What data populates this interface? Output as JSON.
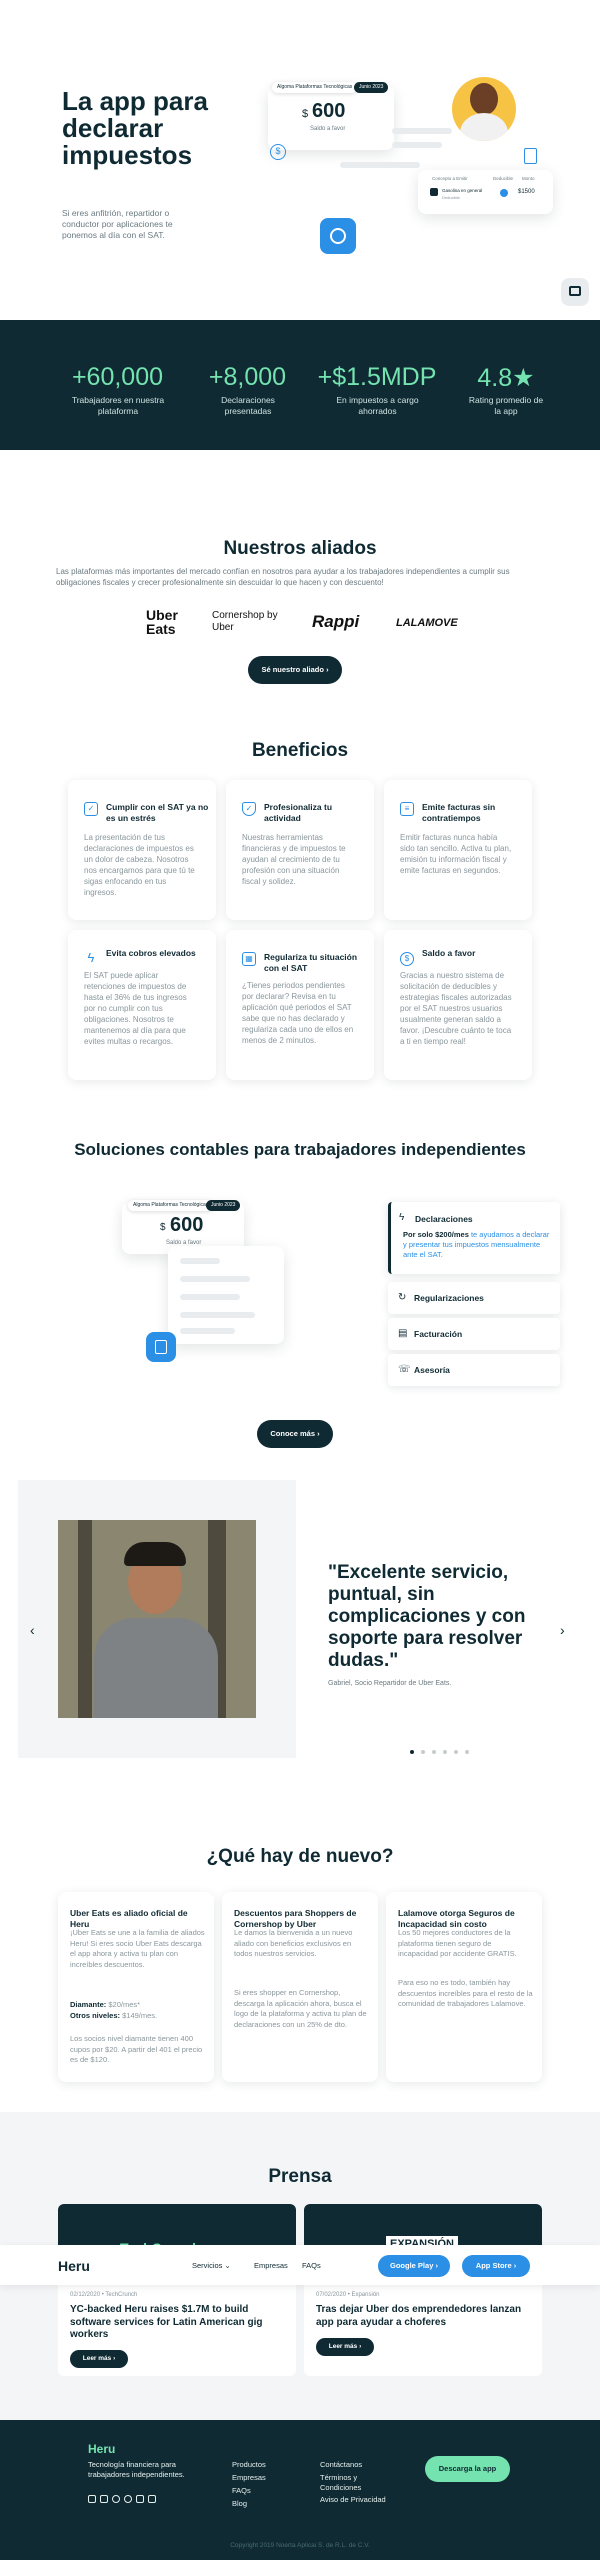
{
  "hero": {
    "title": "La app para declarar impuestos",
    "subtitle": "Si eres anfitrión, repartidor o conductor por aplicaciones te ponemos al día con el SAT.",
    "mock": {
      "badge_left": "Algoma Plataformas Tecnológicas",
      "badge_right": "Junio 2023",
      "amount_symbol": "$",
      "amount": "600",
      "amount_label": "Saldo a favor",
      "table_col1": "Concepto a Emitir",
      "table_col2": "Deducible",
      "table_col3": "Monto",
      "table_row_label": "Gasolina en general",
      "table_row_sub": "Deducible",
      "table_row_amount": "$1500"
    }
  },
  "stats": [
    {
      "value": "+60,000",
      "label": "Trabajadores en nuestra plataforma"
    },
    {
      "value": "+8,000",
      "label": "Declaraciones presentadas"
    },
    {
      "value": "+$1.5MDP",
      "label": "En impuestos a cargo ahorrados"
    },
    {
      "value": "4.8★",
      "label": "Rating promedio de la app"
    }
  ],
  "allies": {
    "title": "Nuestros aliados",
    "subtitle": "Las plataformas más importantes del mercado confían en nosotros para ayudar a los trabajadores independientes a cumplir sus obligaciones fiscales y crecer profesionalmente sin descuidar lo que hacen y con descuento!",
    "logos": [
      "Uber Eats",
      "Cornershop by Uber",
      "Rappi",
      "LALAMOVE"
    ],
    "cta": "Sé nuestro aliado"
  },
  "benefits": {
    "title": "Beneficios",
    "items": [
      {
        "icon": "check-square-icon",
        "title": "Cumplir con el SAT ya no es un estrés",
        "body": "La presentación de tus declaraciones de impuestos es un dolor de cabeza. Nosotros nos encargamos para que tú te sigas enfocando en tus ingresos."
      },
      {
        "icon": "shield-icon",
        "title": "Profesionaliza tu actividad",
        "body": "Nuestras herramientas financieras y de impuestos te ayudan al crecimiento de tu profesión con una situación fiscal y solidez."
      },
      {
        "icon": "document-icon",
        "title": "Emite facturas sin contratiempos",
        "body": "Emitir facturas nunca había sido tan sencillo. Activa tu plan, emisión tu información fiscal y emite facturas en segundos."
      },
      {
        "icon": "bolt-icon",
        "title": "Evita cobros elevados",
        "body": "El SAT puede aplicar retenciones de impuestos de hasta el 36% de tus ingresos por no cumplir con tus obligaciones. Nosotros te mantenemos al día para que evites multas o recargos."
      },
      {
        "icon": "calendar-icon",
        "title": "Regulariza tu situación con el SAT",
        "body": "¿Tienes periodos pendientes por declarar? Revisa en tu aplicación qué periodos el SAT sabe que no has declarado y regulariza cada uno de ellos en menos de 2 minutos."
      },
      {
        "icon": "dollar-icon",
        "title": "Saldo a favor",
        "body": "Gracias a nuestro sistema de solicitación de deducibles y estrategias fiscales autorizadas por el SAT nuestros usuarios usualmente generan saldo a favor. ¡Descubre cuánto te toca a ti en tiempo real!"
      }
    ]
  },
  "solutions": {
    "title": "Soluciones contables para trabajadores independientes",
    "mock": {
      "badge_left": "Algoma Plataformas Tecnológicas",
      "badge_right": "Junio 2023",
      "amount_symbol": "$",
      "amount": "600",
      "amount_label": "Saldo a favor"
    },
    "active": {
      "label": "Declaraciones",
      "desc_bold": "Por solo $200/mes",
      "desc_rest": " te ayudamos a declarar y presentar tus impuestos mensualmente ante el SAT."
    },
    "tabs": [
      {
        "icon": "refresh-icon",
        "label": "Regularizaciones"
      },
      {
        "icon": "receipt-icon",
        "label": "Facturación"
      },
      {
        "icon": "chat-icon",
        "label": "Asesoría"
      }
    ],
    "cta": "Conoce más"
  },
  "testimonial": {
    "quote": "\"Excelente servicio, puntual, sin complicaciones y con soporte para resolver dudas.\"",
    "author": "Gabriel, Socio Repartidor de Uber Eats.",
    "prev": "‹",
    "next": "›"
  },
  "news": {
    "title": "¿Qué hay de nuevo?",
    "items": [
      {
        "title": "Uber Eats es aliado oficial de Heru",
        "paragraphs": [
          "¡Uber Eats se une a la familia de aliados Heru! Si eres socio Uber Eats descarga el app ahora y activa tu plan con increíbles descuentos."
        ],
        "extra1_label": "Diamante:",
        "extra1_value": " $20/mes*",
        "extra2_label": "Otros niveles:",
        "extra2_value": " $149/mes.",
        "footer": "Los socios nivel diamante tienen 400 cupos por $20. A partir del 401 el precio es de $120."
      },
      {
        "title": "Descuentos para Shoppers de Cornershop by Uber",
        "paragraphs": [
          "Le damos la bienvenida a un nuevo aliado con beneficios exclusivos en todos nuestros servicios.",
          "Si eres shopper en Cornershop, descarga la aplicación ahora, busca el logo de la plataforma y activa tu plan de declaraciones con un 25% de dto."
        ]
      },
      {
        "title": "Lalamove otorga Seguros de Incapacidad sin costo",
        "paragraphs": [
          "Los 50 mejores conductores de la plataforma tienen seguro de incapacidad por accidente GRATIS.",
          "Para eso no es todo, también hay descuentos increíbles para el resto de la comunidad de trabajadores Lalamove."
        ]
      }
    ]
  },
  "press": {
    "title": "Prensa",
    "items": [
      {
        "brand": "TechCrunch",
        "date": "02/12/2020",
        "source": "TechCrunch",
        "title": "YC-backed Heru raises $1.7M to build software services for Latin American gig workers",
        "cta": "Leer más"
      },
      {
        "brand": "EXPANSIÓN",
        "date": "07/02/2020",
        "source": "Expansión",
        "title": "Tras dejar Uber dos emprendedores lanzan app para ayudar a choferes",
        "cta": "Leer más"
      }
    ]
  },
  "navbar": {
    "logo": "Heru",
    "links": [
      "Servicios",
      "Empresas",
      "FAQs"
    ],
    "google_play": "Google Play",
    "app_store": "App Store"
  },
  "footer": {
    "logo": "Heru",
    "tagline": "Tecnología financiera para trabajadores independientes.",
    "col1": [
      "Productos",
      "Empresas",
      "FAQs",
      "Blog"
    ],
    "col2": [
      "Contáctanos",
      "Términos y Condiciones",
      "Aviso de Privacidad"
    ],
    "cta": "Descarga la app",
    "copyright": "Copyright 2019 Noerta Aplicai S. de R.L. de C.V."
  },
  "colors": {
    "primary_dark": "#0f2a33",
    "accent_green": "#74e3b0",
    "accent_blue": "#2b8fe5"
  }
}
